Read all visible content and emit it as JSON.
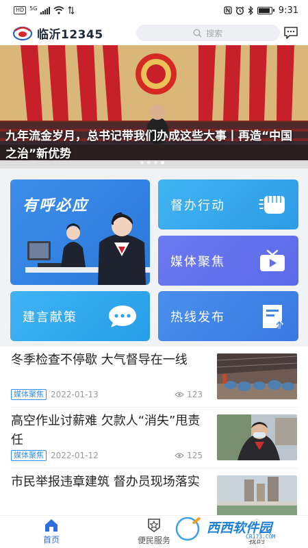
{
  "status_bar": {
    "net_badge": "HD",
    "net_type": "5G",
    "time": "9:31",
    "icons": [
      "nfc-icon",
      "alarm-icon",
      "bluetooth-icon",
      "battery-icon"
    ]
  },
  "header": {
    "app_name": "临沂12345",
    "search_placeholder": "搜索",
    "message_icon": "message-icon"
  },
  "banner": {
    "title": "九年流金岁月，总书记带我们办成这些大事丨再造“中国之治”新优势",
    "dot_count": 4,
    "active_dot": 3
  },
  "tiles": {
    "big": {
      "label": "有呼必应"
    },
    "duban": {
      "label": "督办行动",
      "icon": "fist-icon"
    },
    "meiti": {
      "label": "媒体聚焦",
      "icon": "tv-play-icon"
    },
    "jianyan": {
      "label": "建言献策",
      "icon": "chat-bubble-icon"
    },
    "rexian": {
      "label": "热线发布",
      "icon": "document-upload-icon"
    }
  },
  "news": [
    {
      "title": "冬季检查不停歇  大气督导在一线",
      "tag": "媒体聚焦",
      "date": "2022-01-13",
      "views": "123"
    },
    {
      "title": "高空作业讨薪难  欠款人“消失”甩责任",
      "tag": "媒体聚焦",
      "date": "2022-01-12",
      "views": "125"
    },
    {
      "title": "市民举报违章建筑  督办员现场落实",
      "tag": "",
      "date": "",
      "views": ""
    }
  ],
  "bottom_nav": [
    {
      "label": "首页",
      "icon": "home-icon",
      "active": true
    },
    {
      "label": "便民服务",
      "icon": "star-badge-icon",
      "active": false
    },
    {
      "label": "我的",
      "icon": "user-icon",
      "active": false
    }
  ],
  "watermark": {
    "text": "西西软件园",
    "subtext": "CR173.COM"
  },
  "colors": {
    "accent": "#2d6fe0",
    "tag_blue": "#2d8ff0",
    "banner_red": "#c8202a"
  }
}
